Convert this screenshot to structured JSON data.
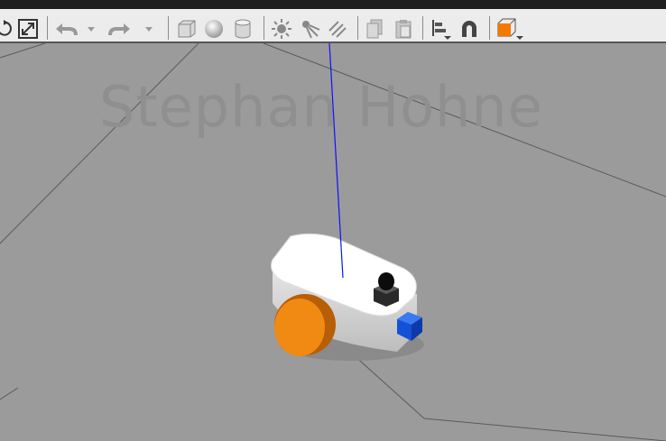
{
  "toolbar": {
    "tools": [
      {
        "name": "rotate-mode-icon",
        "interactable": true
      },
      {
        "name": "scale-mode-icon",
        "interactable": true
      },
      {
        "name": "undo-icon",
        "interactable": true
      },
      {
        "name": "undo-history-chevron-icon",
        "interactable": true
      },
      {
        "name": "redo-icon",
        "interactable": true
      },
      {
        "name": "redo-history-chevron-icon",
        "interactable": true
      },
      {
        "name": "box-shape-icon",
        "interactable": true
      },
      {
        "name": "sphere-shape-icon",
        "interactable": true
      },
      {
        "name": "cylinder-shape-icon",
        "interactable": true
      },
      {
        "name": "point-light-icon",
        "interactable": true
      },
      {
        "name": "spot-light-icon",
        "interactable": true
      },
      {
        "name": "directional-light-icon",
        "interactable": true
      },
      {
        "name": "copy-icon",
        "interactable": true
      },
      {
        "name": "paste-icon",
        "interactable": true
      },
      {
        "name": "align-icon",
        "interactable": true
      },
      {
        "name": "snap-magnet-icon",
        "interactable": true
      },
      {
        "name": "view-angle-icon",
        "interactable": true
      }
    ],
    "accent_color": "#f57900"
  },
  "scene": {
    "watermark": "Stephan Hohne",
    "ground_color": "#9b9b9b",
    "robot": {
      "body_color": "#ffffff",
      "wheel_color": "#f08a12",
      "sensor_color": "#1450d8",
      "z_axis_color": "#1010ff"
    }
  }
}
